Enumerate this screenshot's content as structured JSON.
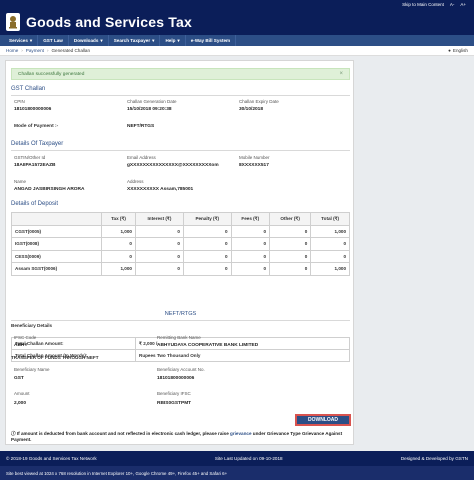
{
  "topbar": {
    "skip": "Skip to Main Content",
    "text_size_decrease": "A-",
    "text_size_increase": "A+"
  },
  "header": {
    "title": "Goods and Services Tax"
  },
  "nav": {
    "items": [
      "Services",
      "GST Law",
      "Downloads",
      "Search Taxpayer",
      "Help",
      "e-Way Bill System"
    ]
  },
  "breadcrumb": {
    "home": "Home",
    "payment": "Payment",
    "current": "Generated Challan",
    "language": "English"
  },
  "alert": {
    "message": "Challan successfully generated"
  },
  "challan": {
    "section": "GST Challan",
    "cpin_label": "CPIN",
    "cpin_value": "18101800000006",
    "gen_date_label": "Challan Generation Date",
    "gen_date_value": "15/10/2018 09:20:38",
    "exp_date_label": "Challan Expiry Date",
    "exp_date_value": "30/10/2018",
    "mode_label": "Mode of Payment :-",
    "mode_value": "NEFT/RTGS"
  },
  "taxpayer": {
    "section": "Details Of Taxpayer",
    "gstin_label": "GSTIN/Other Id",
    "gstin_value": "18AIIPA1572EAZB",
    "email_label": "Email Address",
    "email_value": "gXXXXXXXXXXXXXXX@XXXXXXXXXom",
    "mobile_label": "Mobile Number",
    "mobile_value": "8XXXXXX517",
    "name_label": "Name",
    "name_value": "ANGAD JASBIRSINGH ARORA",
    "address_label": "Address",
    "address_value": "XXXXXXXXXX Assam,785001"
  },
  "deposit": {
    "section": "Details of Deposit",
    "headers": [
      "",
      "Tax (₹)",
      "Interest (₹)",
      "Penalty (₹)",
      "Fees (₹)",
      "Other (₹)",
      "Total (₹)"
    ],
    "rows": [
      [
        "CGST(0005)",
        "1,000",
        "0",
        "0",
        "0",
        "0",
        "1,000"
      ],
      [
        "IGST(0008)",
        "0",
        "0",
        "0",
        "0",
        "0",
        "0"
      ],
      [
        "CESS(0009)",
        "0",
        "0",
        "0",
        "0",
        "0",
        "0"
      ],
      [
        "Assam SGST(0006)",
        "1,000",
        "0",
        "0",
        "0",
        "0",
        "1,000"
      ]
    ],
    "total_label": "Total Challan Amount:",
    "total_value": "₹ 2,000 /-",
    "words_label": "Total Challan Amount (In Words):",
    "words_value": "Rupees Two Thousand Only"
  },
  "neft": {
    "title": "NEFT/RTGS",
    "beneficiary_details": "Beneficiary Details",
    "ifsc_label": "IFSC Code",
    "ifsc_value": "ABHY",
    "bank_label": "Remitting Bank Name",
    "bank_value": "ABHYUDAYA COOPERATIVE BANK LIMITED",
    "transfer_title": "TRANSFER OF FUNDS THROUGH NEFT",
    "ben_name_label": "Beneficiary Name",
    "ben_name_value": "GST",
    "ben_acc_label": "Beneficiary Account No.",
    "ben_acc_value": "18101800000006",
    "amount_label": "Amount",
    "amount_value": "2,000",
    "ben_ifsc_label": "Beneficiary IFSC",
    "ben_ifsc_value": "RBIS0GSTPMT"
  },
  "actions": {
    "download": "DOWNLOAD"
  },
  "note": {
    "pre": "If amount is deducted from bank account and not reflected in electronic cash ledger, please raise",
    "link": "grievance",
    "post": "under Grievance Type Grievance Against Payment."
  },
  "footer": {
    "copyright": "© 2018-19 Goods and Services Tax Network",
    "updated": "Site Last Updated on 09-10-2018",
    "developed": "Designed & Developed by GSTN",
    "browser_note": "Site best viewed at 1024 x 768 resolution in Internet Explorer 10+, Google Chrome 49+, Firefox 45+ and Safari 6+"
  }
}
